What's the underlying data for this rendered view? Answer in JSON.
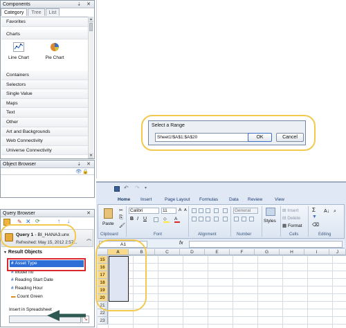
{
  "components": {
    "title": "Components",
    "controls": "⇣ ✕",
    "tabs": [
      "Category",
      "Tree",
      "List"
    ],
    "favorites": "Favorites",
    "charts_header": "Charts",
    "charts": [
      {
        "label": "Line Chart",
        "icon": "line-chart-icon"
      },
      {
        "label": "Pie Chart",
        "icon": "pie-chart-icon"
      }
    ],
    "categories": [
      "Containers",
      "Selectors",
      "Single Value",
      "Maps",
      "Text",
      "Other",
      "Art and Backgrounds",
      "Web Connectivity",
      "Universe Connectivity"
    ]
  },
  "object_browser": {
    "title": "Object Browser",
    "controls": "⇣ ✕"
  },
  "query_browser": {
    "title": "Query Browser",
    "close": "✕",
    "query_title": "Query 1",
    "query_source": " - BI_HANA3.unx",
    "refreshed": "Refreshed: May 15, 2012 2:57...",
    "result_objects_label": "Result Objects",
    "items": [
      {
        "label": "Asset Type",
        "selected": true
      },
      {
        "label": "Model no",
        "selected": false
      },
      {
        "label": "Reading Start Date",
        "selected": false
      },
      {
        "label": "Reading Hour",
        "selected": false
      },
      {
        "label": "Count Green",
        "selected": false
      }
    ],
    "insert_label": "Insert in Spreadsheet"
  },
  "dialog": {
    "title": "Select a Range",
    "value": "Sheet1!$A$1:$A$20",
    "ok": "OK",
    "cancel": "Cancel"
  },
  "excel": {
    "ribbon_tabs": [
      "Home",
      "Insert",
      "Page Layout",
      "Formulas",
      "Data",
      "Review",
      "View"
    ],
    "font_name": "Calibri",
    "font_size": "11",
    "number_format": "General",
    "paste": "Paste",
    "styles": "Styles",
    "insert_btn": "Insert",
    "delete_btn": "Delete",
    "format_btn": "Format",
    "groups": [
      "Clipboard",
      "Font",
      "Alignment",
      "Number",
      "Cells",
      "Editing"
    ],
    "name_box": "A1",
    "fx": "fx",
    "columns": [
      "A",
      "B",
      "C",
      "D",
      "E",
      "F",
      "G",
      "H",
      "I",
      "J"
    ],
    "rows": [
      "15",
      "16",
      "17",
      "18",
      "19",
      "20",
      "21",
      "22",
      "23"
    ]
  },
  "colors": {
    "highlight_circle": "#f2c94c",
    "selection_blue": "#2d6fd6",
    "red_box": "#d9272e",
    "arrow": "#2e5a53"
  }
}
